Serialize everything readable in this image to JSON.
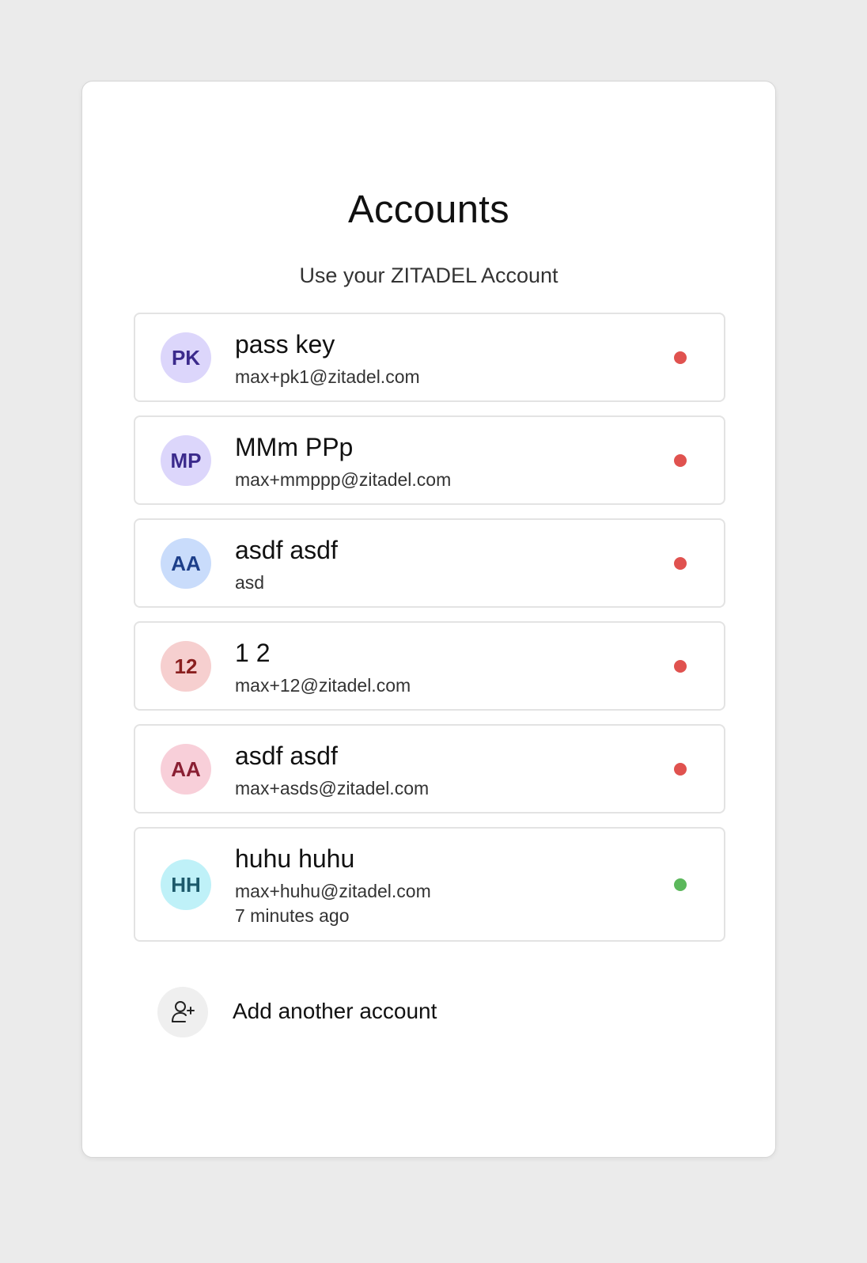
{
  "page": {
    "title": "Accounts",
    "subtitle": "Use your ZITADEL Account"
  },
  "accounts": [
    {
      "initials": "PK",
      "name": "pass key",
      "email": "max+pk1@zitadel.com",
      "meta": "",
      "status": "inactive",
      "avatar_bg": "#dcd6fb",
      "avatar_fg": "#3b2a8c",
      "status_color": "#e0524f"
    },
    {
      "initials": "MP",
      "name": "MMm PPp",
      "email": "max+mmppp@zitadel.com",
      "meta": "",
      "status": "inactive",
      "avatar_bg": "#dcd6fb",
      "avatar_fg": "#3b2a8c",
      "status_color": "#e0524f"
    },
    {
      "initials": "AA",
      "name": "asdf asdf",
      "email": "asd",
      "meta": "",
      "status": "inactive",
      "avatar_bg": "#c9dcfb",
      "avatar_fg": "#1d3f8a",
      "status_color": "#e0524f"
    },
    {
      "initials": "12",
      "name": "1 2",
      "email": "max+12@zitadel.com",
      "meta": "",
      "status": "inactive",
      "avatar_bg": "#f6cfcf",
      "avatar_fg": "#8a1f1f",
      "status_color": "#e0524f"
    },
    {
      "initials": "AA",
      "name": "asdf asdf",
      "email": "max+asds@zitadel.com",
      "meta": "",
      "status": "inactive",
      "avatar_bg": "#f8cfd9",
      "avatar_fg": "#8a1f33",
      "status_color": "#e0524f"
    },
    {
      "initials": "HH",
      "name": "huhu huhu",
      "email": "max+huhu@zitadel.com",
      "meta": "7 minutes ago",
      "status": "active",
      "avatar_bg": "#bff1f8",
      "avatar_fg": "#1d5a6b",
      "status_color": "#5cb85c"
    }
  ],
  "add_account": {
    "label": "Add another account",
    "icon": "user-plus-icon"
  }
}
